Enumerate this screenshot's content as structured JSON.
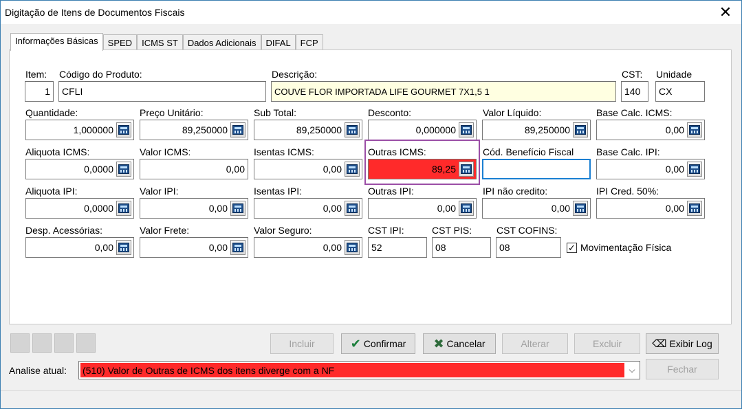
{
  "window": {
    "title": "Digitação de Itens de Documentos Fiscais",
    "close_label": "✕"
  },
  "tabs": [
    "Informações Básicas",
    "SPED",
    "ICMS ST",
    "Dados Adicionais",
    "DIFAL",
    "FCP"
  ],
  "fields": {
    "item": {
      "label": "Item:",
      "value": "1"
    },
    "codigo": {
      "label": "Código do Produto:",
      "value": "CFLI"
    },
    "descricao": {
      "label": "Descrição:",
      "value": "COUVE FLOR IMPORTADA LIFE GOURMET 7X1,5     1"
    },
    "cst": {
      "label": "CST:",
      "value": "140"
    },
    "unidade": {
      "label": "Unidade",
      "value": "CX"
    },
    "quantidade": {
      "label": "Quantidade:",
      "value": "1,000000"
    },
    "preco": {
      "label": "Preço Unitário:",
      "value": "89,250000"
    },
    "subtotal": {
      "label": "Sub Total:",
      "value": "89,250000"
    },
    "desconto": {
      "label": "Desconto:",
      "value": "0,000000"
    },
    "valor_liquido": {
      "label": "Valor Líquido:",
      "value": "89,250000"
    },
    "base_icms": {
      "label": "Base Calc. ICMS:",
      "value": "0,00"
    },
    "aliquota_icms": {
      "label": "Aliquota ICMS:",
      "value": "0,0000"
    },
    "valor_icms": {
      "label": "Valor ICMS:",
      "value": "0,00"
    },
    "isentas_icms": {
      "label": "Isentas ICMS:",
      "value": "0,00"
    },
    "outras_icms": {
      "label": "Outras ICMS:",
      "value": "89,25"
    },
    "cod_beneficio": {
      "label": "Cód. Benefício Fiscal",
      "value": ""
    },
    "base_ipi": {
      "label": "Base Calc. IPI:",
      "value": "0,00"
    },
    "aliquota_ipi": {
      "label": "Aliquota IPI:",
      "value": "0,0000"
    },
    "valor_ipi": {
      "label": "Valor IPI:",
      "value": "0,00"
    },
    "isentas_ipi": {
      "label": "Isentas IPI:",
      "value": "0,00"
    },
    "outras_ipi": {
      "label": "Outras IPI:",
      "value": "0,00"
    },
    "ipi_nao_credito": {
      "label": "IPI não credito:",
      "value": "0,00"
    },
    "ipi_cred_50": {
      "label": "IPI Cred. 50%:",
      "value": "0,00"
    },
    "desp_acessorias": {
      "label": "Desp. Acessórias:",
      "value": "0,00"
    },
    "valor_frete": {
      "label": "Valor Frete:",
      "value": "0,00"
    },
    "valor_seguro": {
      "label": "Valor Seguro:",
      "value": "0,00"
    },
    "cst_ipi": {
      "label": "CST IPI:",
      "value": "52"
    },
    "cst_pis": {
      "label": "CST PIS:",
      "value": "08"
    },
    "cst_cofins": {
      "label": "CST COFINS:",
      "value": "08"
    }
  },
  "movimentacao": {
    "label": "Movimentação Física",
    "checked": true,
    "mark": "✓"
  },
  "buttons": {
    "incluir": "Incluir",
    "confirmar": "Confirmar",
    "cancelar": "Cancelar",
    "alterar": "Alterar",
    "excluir": "Excluir",
    "exibir_log": "Exibir Log",
    "fechar": "Fechar"
  },
  "icons": {
    "confirmar": "checkmark-icon",
    "cancelar": "x-icon",
    "exibir_log": "eraser-icon",
    "calc": "calculator-icon"
  },
  "analise": {
    "label": "Analise atual:",
    "value": "(510) Valor de Outras de ICMS dos itens diverge com a NF"
  },
  "colors": {
    "error_red": "#ff2a2a",
    "highlight_purple": "#9b4ea6",
    "desc_yellow": "#ffffe1",
    "focus_blue": "#1a7fd2"
  }
}
